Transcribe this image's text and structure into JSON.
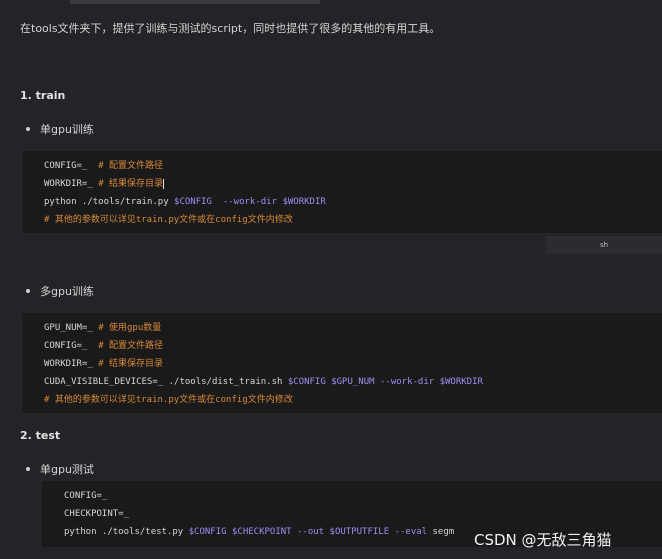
{
  "intro": "在tools文件夹下，提供了训练与测试的script，同时也提供了很多的其他的有用工具。",
  "sections": {
    "train": {
      "heading": "1. train",
      "single_gpu": {
        "label": "单gpu训练",
        "lines": [
          {
            "a": "CONFIG=_",
            "b": "  ",
            "c": "# 配置文件路径"
          },
          {
            "a": "WORKDIR=_",
            "b": " ",
            "c": "# 结果保存目录"
          },
          {
            "a": "python ./tools/train.py ",
            "var1": "$CONFIG",
            "flag": "  --work-dir ",
            "var2": "$WORKDIR"
          },
          {
            "c": "# 其他的参数可以详见train.py文件或在config文件内修改"
          }
        ],
        "lang": "sh"
      },
      "multi_gpu": {
        "label": "多gpu训练",
        "lines": [
          {
            "a": "GPU_NUM=_",
            "b": " ",
            "c": "# 使用gpu数量"
          },
          {
            "a": "CONFIG=_",
            "b": "  ",
            "c": "# 配置文件路径"
          },
          {
            "a": "WORKDIR=_",
            "b": " ",
            "c": "# 结果保存目录"
          },
          {
            "a": "CUDA_VISIBLE_DEVICES=_ ./tools/dist_train.sh ",
            "var1": "$CONFIG",
            "sp": " ",
            "var2": "$GPU_NUM",
            "flag": " --work-dir ",
            "var3": "$WORKDIR"
          },
          {
            "c": "# 其他的参数可以详见train.py文件或在config文件内修改"
          }
        ]
      }
    },
    "test": {
      "heading": "2. test",
      "single_gpu": {
        "label": "单gpu测试",
        "lines": [
          {
            "a": "CONFIG=_"
          },
          {
            "a": "CHECKPOINT=_"
          },
          {
            "a": "python ./tools/test.py ",
            "var1": "$CONFIG",
            "sp": " ",
            "var2": "$CHECKPOINT",
            "flag": " --out ",
            "var3": "$OUTPUTFILE",
            "flag2": " --eval ",
            "tail": "segm"
          }
        ]
      }
    }
  },
  "watermark": "CSDN @无敌三角猫",
  "colors": {
    "background": "#232427",
    "code_bg": "#1a1a1b",
    "keyword": "#9d8ff0",
    "comment": "#d98a3a"
  }
}
